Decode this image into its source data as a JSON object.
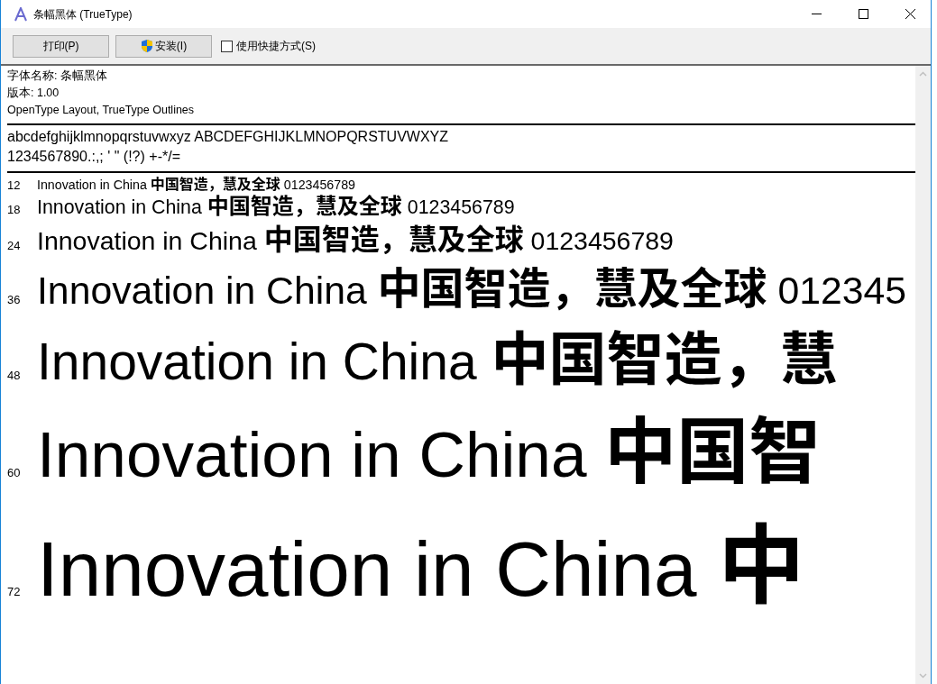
{
  "window": {
    "title": "条幅黑体 (TrueType)"
  },
  "toolbar": {
    "buttons": [
      {
        "kind": "plain",
        "label": "打印(P)"
      },
      {
        "kind": "shield",
        "label": "安装(I)"
      }
    ],
    "shortcut_checkbox": {
      "label": "使用快捷方式(S)",
      "checked": false
    }
  },
  "font_info": [
    "字体名称: 条幅黑体",
    "版本: 1.00",
    "OpenType Layout, TrueType Outlines"
  ],
  "charset": [
    "abcdefghijklmnopqrstuvwxyz ABCDEFGHIJKLMNOPQRSTUVWXYZ",
    "1234567890.:,; ' \" (!?) +-*/="
  ],
  "samples": [
    {
      "size": "12",
      "latin": "Innovation in China",
      "cjk": "中国智造，慧及全球",
      "digits": "0123456789"
    },
    {
      "size": "18",
      "latin": "Innovation in China",
      "cjk": "中国智造，慧及全球",
      "digits": "0123456789"
    },
    {
      "size": "24",
      "latin": "Innovation in China",
      "cjk": "中国智造，慧及全球",
      "digits": "0123456789"
    },
    {
      "size": "36",
      "latin": "Innovation in China",
      "cjk": "中国智造，慧及全球",
      "digits": "012345"
    },
    {
      "size": "48",
      "latin": "Innovation in China",
      "cjk": "中国智造，慧"
    },
    {
      "size": "60",
      "latin": "Innovation in China",
      "cjk": "中国智"
    },
    {
      "size": "72",
      "latin": "Innovation in China",
      "cjk": "中"
    }
  ]
}
